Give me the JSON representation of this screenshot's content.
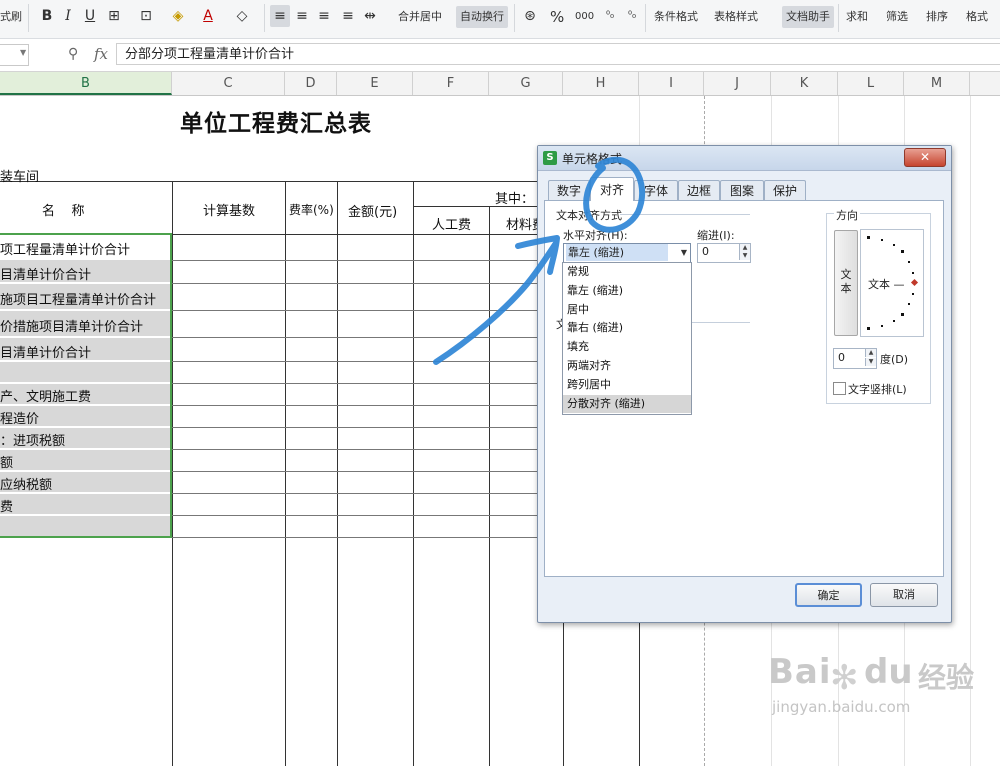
{
  "toolbar": {
    "format_painter": "式刷",
    "merge_center": "合并居中",
    "wrap_text": "自动换行",
    "percent": "%",
    "thousands": "000",
    "cond_format": "条件格式",
    "table_style": "表格样式",
    "doc_helper": "文档助手",
    "sum": "求和",
    "filter": "筛选",
    "sort": "排序",
    "format": "格式",
    "accent_color": "#217346"
  },
  "formula_bar": {
    "fx": "fx",
    "content": "分部分项工程量清单计价合计"
  },
  "columns": [
    "B",
    "C",
    "D",
    "E",
    "F",
    "G",
    "H",
    "I",
    "J",
    "K",
    "L",
    "M"
  ],
  "sheet": {
    "title": "单位工程费汇总表",
    "project": "装车间",
    "headers": {
      "name": "名    称",
      "calc_base": "计算基数",
      "rate": "费率(%)",
      "amount": "金额(元)",
      "among": "其中：",
      "labor": "人工费",
      "material": "材料费"
    },
    "rows": [
      "项工程量清单计价合计",
      "目清单计价合计",
      "施项目工程量清单计价合计",
      "价措施项目清单计价合计",
      "目清单计价合计",
      "",
      "产、文明施工费",
      "程造价",
      "：进项税额",
      "额",
      "应纳税额",
      "费",
      ""
    ]
  },
  "dialog": {
    "title": "单元格格式",
    "tabs": [
      "数字",
      "对齐",
      "字体",
      "边框",
      "图案",
      "保护"
    ],
    "active_tab": "对齐",
    "text_align_group": "文本对齐方式",
    "halign_label": "水平对齐(H):",
    "halign_value": "靠左 (缩进)",
    "indent_label": "缩进(I):",
    "indent_value": "0",
    "text_control_partial": "文",
    "halign_options": [
      "常规",
      "靠左 (缩进)",
      "居中",
      "靠右 (缩进)",
      "填充",
      "两端对齐",
      "跨列居中",
      "分散对齐 (缩进)"
    ],
    "orientation_group": "方向",
    "vertical_text_label": "文本",
    "dial_text": "文本 —",
    "degree_value": "0",
    "degree_label": "度(D)",
    "vertical_check_label": "文字竖排(L)",
    "ok": "确定",
    "cancel": "取消"
  },
  "watermark": {
    "brand": "Bai",
    "brand2": "du",
    "jingyan": "经验",
    "url": "jingyan.baidu.com"
  }
}
